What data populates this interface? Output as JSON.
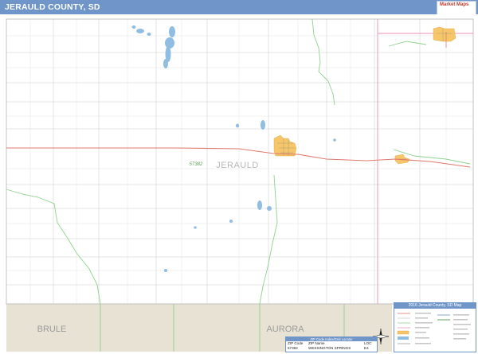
{
  "title": "JERAULD COUNTY, SD",
  "logo": {
    "brand": "Market Maps",
    "tagline": ""
  },
  "colors": {
    "header": "#6f95c9",
    "city": "#f7c669",
    "water": "#8fbde3",
    "zip_boundary": "#8ed28e",
    "highway": "#e07a6c",
    "county_line": "#e893b8",
    "neighbor": "#e7e2d4"
  },
  "map": {
    "county_label": "JERAULD",
    "zip_label": "57382",
    "neighbors": [
      "BRULE",
      "AURORA"
    ]
  },
  "legend": {
    "title": "2016 Jerauld County, SD Map"
  },
  "zip_index": {
    "title": "ZIP Code Index/Grid Locator",
    "headers": [
      "ZIP Code",
      "ZIP Name",
      "LOC"
    ],
    "rows": [
      [
        "57382",
        "WESSINGTON SPRINGS",
        "E4"
      ]
    ]
  },
  "north_icon": "compass-rose-icon",
  "scale_icon": "scale-bar-icon"
}
